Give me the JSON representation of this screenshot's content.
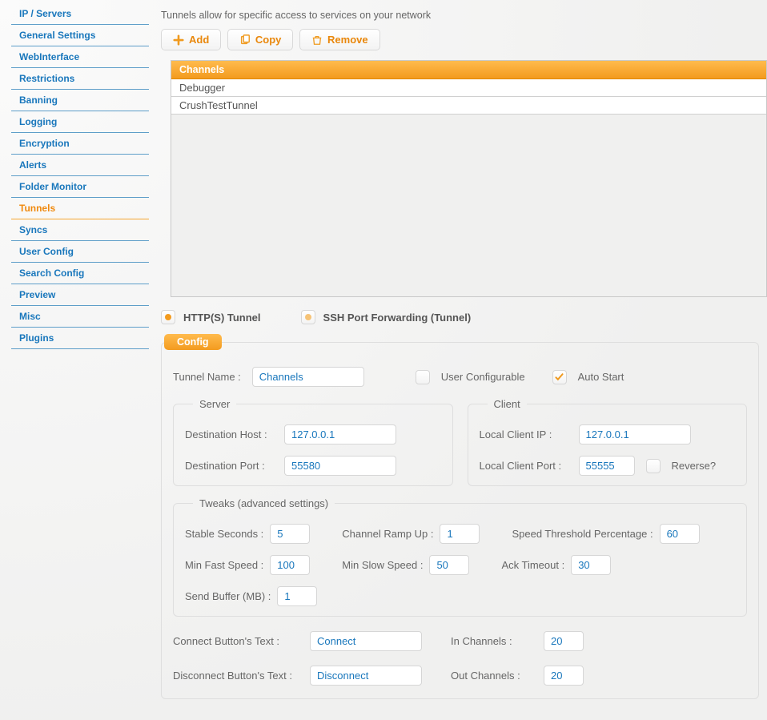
{
  "sidebar": {
    "items": [
      {
        "label": "IP / Servers",
        "active": false
      },
      {
        "label": "General Settings",
        "active": false
      },
      {
        "label": "WebInterface",
        "active": false
      },
      {
        "label": "Restrictions",
        "active": false
      },
      {
        "label": "Banning",
        "active": false
      },
      {
        "label": "Logging",
        "active": false
      },
      {
        "label": "Encryption",
        "active": false
      },
      {
        "label": "Alerts",
        "active": false
      },
      {
        "label": "Folder Monitor",
        "active": false
      },
      {
        "label": "Tunnels",
        "active": true
      },
      {
        "label": "Syncs",
        "active": false
      },
      {
        "label": "User Config",
        "active": false
      },
      {
        "label": "Search Config",
        "active": false
      },
      {
        "label": "Preview",
        "active": false
      },
      {
        "label": "Misc",
        "active": false
      },
      {
        "label": "Plugins",
        "active": false
      }
    ]
  },
  "helper_text": "Tunnels allow for specific access to services on your network",
  "toolbar": {
    "add_label": "Add",
    "copy_label": "Copy",
    "remove_label": "Remove"
  },
  "channels": {
    "header": "Channels",
    "rows": [
      "Debugger",
      "CrushTestTunnel"
    ]
  },
  "tunnel_type": {
    "http_label": "HTTP(S) Tunnel",
    "ssh_label": "SSH Port Forwarding (Tunnel)"
  },
  "config": {
    "tab_label": "Config",
    "tunnel_name_label": "Tunnel Name :",
    "tunnel_name_value": "Channels",
    "user_configurable_label": "User Configurable",
    "auto_start_label": "Auto Start",
    "server": {
      "legend": "Server",
      "dest_host_label": "Destination Host :",
      "dest_host_value": "127.0.0.1",
      "dest_port_label": "Destination Port :",
      "dest_port_value": "55580"
    },
    "client": {
      "legend": "Client",
      "local_ip_label": "Local Client IP :",
      "local_ip_value": "127.0.0.1",
      "local_port_label": "Local Client Port :",
      "local_port_value": "55555",
      "reverse_label": "Reverse?"
    },
    "tweaks": {
      "legend": "Tweaks (advanced settings)",
      "stable_seconds_label": "Stable Seconds :",
      "stable_seconds_value": "5",
      "channel_ramp_label": "Channel Ramp Up :",
      "channel_ramp_value": "1",
      "speed_threshold_label": "Speed Threshold Percentage :",
      "speed_threshold_value": "60",
      "min_fast_label": "Min Fast Speed :",
      "min_fast_value": "100",
      "min_slow_label": "Min Slow Speed :",
      "min_slow_value": "50",
      "ack_timeout_label": "Ack Timeout :",
      "ack_timeout_value": "30",
      "send_buffer_label": "Send Buffer (MB) :",
      "send_buffer_value": "1"
    },
    "extras": {
      "connect_label": "Connect Button's Text :",
      "connect_value": "Connect",
      "disconnect_label": "Disconnect Button's Text :",
      "disconnect_value": "Disconnect",
      "in_channels_label": "In Channels :",
      "in_channels_value": "20",
      "out_channels_label": "Out Channels :",
      "out_channels_value": "20"
    }
  }
}
